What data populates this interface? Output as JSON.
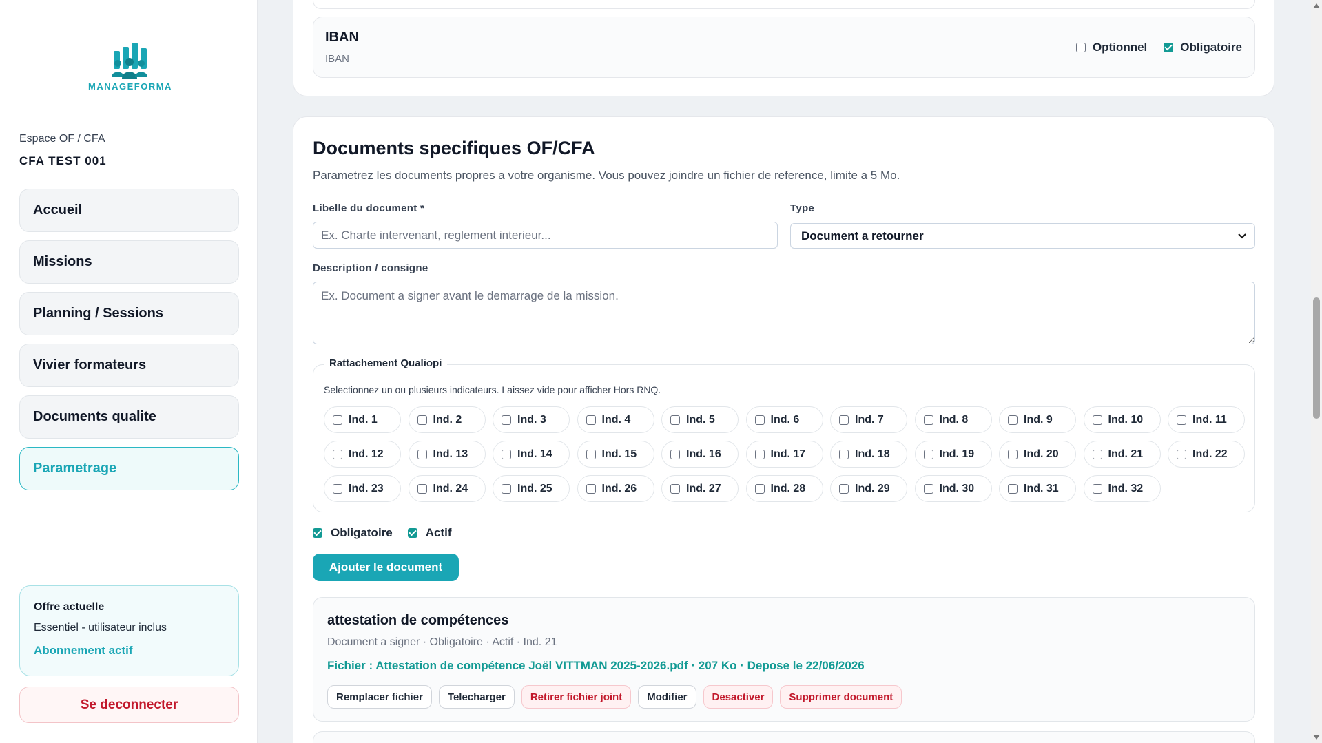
{
  "sidebar": {
    "logo_text": "MANAGEFORMA",
    "space_label": "Espace OF / CFA",
    "org_name": "CFA TEST 001",
    "nav": [
      {
        "label": "Accueil"
      },
      {
        "label": "Missions"
      },
      {
        "label": "Planning / Sessions"
      },
      {
        "label": "Vivier formateurs"
      },
      {
        "label": "Documents qualite"
      },
      {
        "label": "Parametrage",
        "active": true
      }
    ],
    "offer": {
      "title": "Offre actuelle",
      "plan": "Essentiel - utilisateur inclus",
      "status": "Abonnement actif"
    },
    "logout_label": "Se deconnecter"
  },
  "iban_field": {
    "title": "IBAN",
    "subtitle": "IBAN",
    "optional_label": "Optionnel",
    "optional_checked": false,
    "mandatory_label": "Obligatoire",
    "mandatory_checked": true
  },
  "docs_section": {
    "title": "Documents specifiques OF/CFA",
    "subtitle": "Parametrez les documents propres a votre organisme. Vous pouvez joindre un fichier de reference, limite a 5 Mo.",
    "label_field": {
      "label": "Libelle du document *",
      "placeholder": "Ex. Charte intervenant, reglement interieur...",
      "value": ""
    },
    "type_field": {
      "label": "Type",
      "selected": "Document a retourner"
    },
    "description_field": {
      "label": "Description / consigne",
      "placeholder": "Ex. Document a signer avant le demarrage de la mission."
    },
    "qualiopi": {
      "legend": "Rattachement Qualiopi",
      "help": "Selectionnez un ou plusieurs indicateurs. Laissez vide pour afficher Hors RNQ.",
      "indicators": [
        "Ind. 1",
        "Ind. 2",
        "Ind. 3",
        "Ind. 4",
        "Ind. 5",
        "Ind. 6",
        "Ind. 7",
        "Ind. 8",
        "Ind. 9",
        "Ind. 10",
        "Ind. 11",
        "Ind. 12",
        "Ind. 13",
        "Ind. 14",
        "Ind. 15",
        "Ind. 16",
        "Ind. 17",
        "Ind. 18",
        "Ind. 19",
        "Ind. 20",
        "Ind. 21",
        "Ind. 22",
        "Ind. 23",
        "Ind. 24",
        "Ind. 25",
        "Ind. 26",
        "Ind. 27",
        "Ind. 28",
        "Ind. 29",
        "Ind. 30",
        "Ind. 31",
        "Ind. 32"
      ]
    },
    "mandatory_label": "Obligatoire",
    "mandatory_checked": true,
    "active_label": "Actif",
    "active_checked": true,
    "add_button": "Ajouter le document"
  },
  "documents": [
    {
      "name": "attestation de compétences",
      "meta": "Document a signer · Obligatoire · Actif · Ind. 21",
      "file": "Fichier : Attestation de compétence Joël VITTMAN 2025-2026.pdf · 207 Ko · Depose le 22/06/2026",
      "actions": {
        "replace": "Remplacer fichier",
        "download": "Telecharger",
        "remove_file": "Retirer fichier joint",
        "edit": "Modifier",
        "deactivate": "Desactiver",
        "delete": "Supprimer document"
      }
    }
  ],
  "colors": {
    "brand": "#1aa6b5",
    "check": "#129a94",
    "danger": "#c2182b"
  }
}
